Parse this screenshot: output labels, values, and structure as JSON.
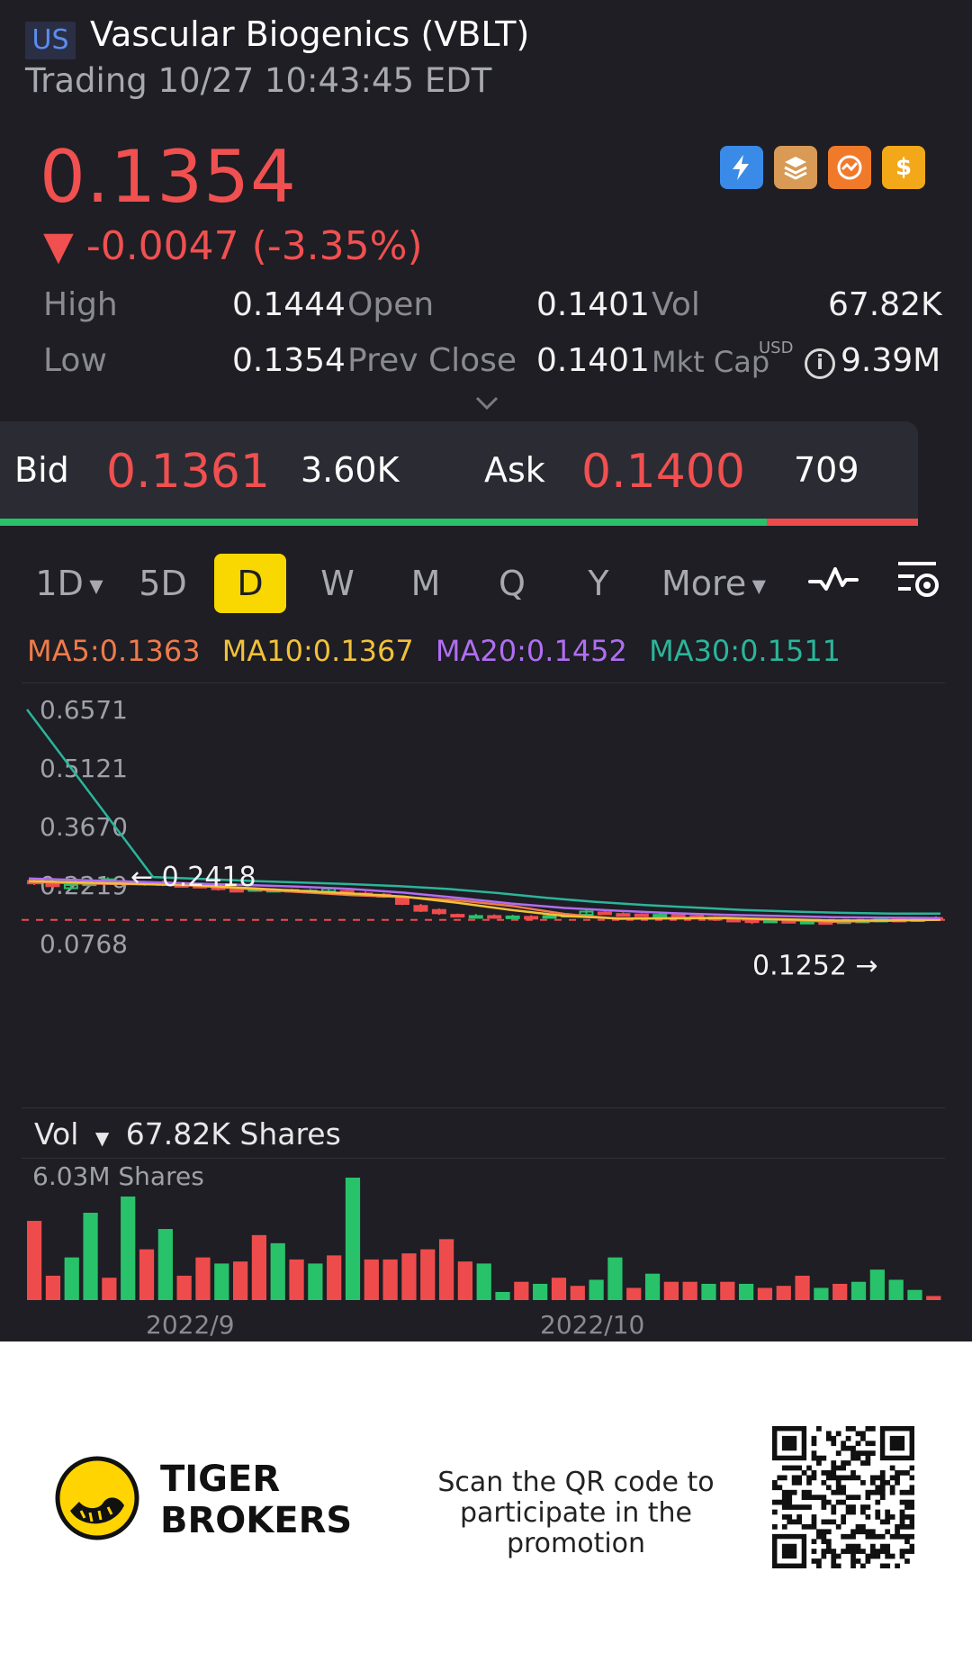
{
  "header": {
    "market": "US",
    "title": "Vascular Biogenics (VBLT)",
    "subtitle": "Trading 10/27 10:43:45 EDT"
  },
  "quote": {
    "price": "0.1354",
    "change": "▼ -0.0047 (-3.35%)",
    "high_label": "High",
    "high": "0.1444",
    "low_label": "Low",
    "low": "0.1354",
    "open_label": "Open",
    "open": "0.1401",
    "prev_close_label": "Prev Close",
    "prev_close": "0.1401",
    "vol_label": "Vol",
    "vol": "67.82K",
    "mkt_cap_label": "Mkt Cap",
    "mkt_cap_currency": "USD",
    "mkt_cap": "9.39M"
  },
  "bidask": {
    "bid_label": "Bid",
    "bid": "0.1361",
    "bid_size": "3.60K",
    "ask_label": "Ask",
    "ask": "0.1400",
    "ask_size": "709",
    "bid_ratio": 0.835
  },
  "tabs": [
    "1D",
    "5D",
    "D",
    "W",
    "M",
    "Q",
    "Y",
    "More"
  ],
  "active_tab": "D",
  "ma": {
    "ma5": "MA5:0.1363",
    "ma10": "MA10:0.1367",
    "ma20": "MA20:0.1452",
    "ma30": "MA30:0.1511"
  },
  "colors": {
    "up": "#28c26a",
    "down": "#ee4c4c",
    "ma5": "#f07a4a",
    "ma10": "#f2c13a",
    "ma20": "#b06ef2",
    "ma30": "#2bb59a",
    "accent": "#f8d800"
  },
  "chart_data": {
    "type": "line",
    "y_ticks": [
      "0.6571",
      "0.5121",
      "0.3670",
      "0.2219",
      "0.0768"
    ],
    "ylim": [
      0.0768,
      0.6571
    ],
    "max_marker": "0.2418",
    "min_marker": "0.1252",
    "current_price_line": 0.1354,
    "x_ticks": [
      "2022/9",
      "2022/10"
    ],
    "series": [
      {
        "name": "MA5",
        "values": [
          0.23,
          0.226,
          0.224,
          0.221,
          0.213,
          0.205,
          0.197,
          0.192,
          0.184,
          0.17,
          0.15,
          0.138,
          0.14,
          0.141,
          0.136,
          0.131,
          0.133,
          0.136
        ]
      },
      {
        "name": "MA10",
        "values": [
          0.232,
          0.228,
          0.225,
          0.222,
          0.215,
          0.208,
          0.201,
          0.193,
          0.178,
          0.16,
          0.145,
          0.139,
          0.139,
          0.14,
          0.137,
          0.134,
          0.134,
          0.136
        ]
      },
      {
        "name": "MA20",
        "values": [
          0.238,
          0.234,
          0.23,
          0.226,
          0.222,
          0.218,
          0.212,
          0.203,
          0.19,
          0.176,
          0.165,
          0.158,
          0.152,
          0.148,
          0.145,
          0.142,
          0.141,
          0.14
        ]
      },
      {
        "name": "MA30",
        "values": [
          0.6571,
          0.2418,
          0.237,
          0.232,
          0.228,
          0.224,
          0.219,
          0.212,
          0.202,
          0.19,
          0.18,
          0.172,
          0.166,
          0.16,
          0.156,
          0.153,
          0.151,
          0.1511
        ]
      }
    ],
    "candles": [
      [
        0.232,
        0.226,
        0.236,
        0.222
      ],
      [
        0.226,
        0.219,
        0.23,
        0.216
      ],
      [
        0.214,
        0.222,
        0.226,
        0.211
      ],
      [
        0.222,
        0.226,
        0.23,
        0.219
      ],
      [
        0.23,
        0.236,
        0.241,
        0.228
      ],
      [
        0.23,
        0.225,
        0.234,
        0.221
      ],
      [
        0.224,
        0.228,
        0.232,
        0.22
      ],
      [
        0.228,
        0.222,
        0.233,
        0.219
      ],
      [
        0.222,
        0.22,
        0.226,
        0.216
      ],
      [
        0.22,
        0.218,
        0.224,
        0.214
      ],
      [
        0.216,
        0.213,
        0.22,
        0.208
      ],
      [
        0.21,
        0.208,
        0.214,
        0.204
      ],
      [
        0.208,
        0.212,
        0.216,
        0.205
      ],
      [
        0.21,
        0.21,
        0.214,
        0.206
      ],
      [
        0.21,
        0.208,
        0.213,
        0.204
      ],
      [
        0.208,
        0.208,
        0.212,
        0.203
      ],
      [
        0.206,
        0.213,
        0.215,
        0.203
      ],
      [
        0.207,
        0.201,
        0.21,
        0.198
      ],
      [
        0.201,
        0.198,
        0.206,
        0.194
      ],
      [
        0.198,
        0.193,
        0.202,
        0.19
      ],
      [
        0.19,
        0.175,
        0.195,
        0.172
      ],
      [
        0.17,
        0.158,
        0.175,
        0.155
      ],
      [
        0.16,
        0.152,
        0.164,
        0.148
      ],
      [
        0.148,
        0.146,
        0.151,
        0.143
      ],
      [
        0.143,
        0.145,
        0.15,
        0.14
      ],
      [
        0.145,
        0.142,
        0.149,
        0.139
      ],
      [
        0.142,
        0.144,
        0.148,
        0.14
      ],
      [
        0.143,
        0.142,
        0.147,
        0.139
      ],
      [
        0.141,
        0.145,
        0.149,
        0.139
      ],
      [
        0.146,
        0.148,
        0.152,
        0.143
      ],
      [
        0.148,
        0.156,
        0.16,
        0.146
      ],
      [
        0.154,
        0.151,
        0.158,
        0.148
      ],
      [
        0.15,
        0.149,
        0.154,
        0.146
      ],
      [
        0.149,
        0.147,
        0.152,
        0.144
      ],
      [
        0.146,
        0.148,
        0.152,
        0.143
      ],
      [
        0.147,
        0.146,
        0.15,
        0.143
      ],
      [
        0.145,
        0.143,
        0.148,
        0.14
      ],
      [
        0.142,
        0.136,
        0.145,
        0.133
      ],
      [
        0.136,
        0.135,
        0.139,
        0.132
      ],
      [
        0.135,
        0.13,
        0.137,
        0.1252
      ],
      [
        0.131,
        0.134,
        0.137,
        0.129
      ],
      [
        0.133,
        0.132,
        0.136,
        0.129
      ],
      [
        0.131,
        0.131,
        0.134,
        0.128
      ],
      [
        0.13,
        0.128,
        0.133,
        0.126
      ],
      [
        0.128,
        0.132,
        0.135,
        0.127
      ],
      [
        0.131,
        0.134,
        0.137,
        0.129
      ],
      [
        0.134,
        0.136,
        0.139,
        0.132
      ],
      [
        0.136,
        0.135,
        0.14,
        0.132
      ],
      [
        0.136,
        0.137,
        0.141,
        0.133
      ],
      [
        0.14,
        0.1354,
        0.1444,
        0.1354
      ]
    ]
  },
  "volume": {
    "header": "Vol",
    "current": "67.82K Shares",
    "max_label": "6.03M Shares",
    "max": 6.03,
    "bars": [
      {
        "v": 3.9,
        "up": false
      },
      {
        "v": 1.2,
        "up": false
      },
      {
        "v": 2.1,
        "up": true
      },
      {
        "v": 4.3,
        "up": true
      },
      {
        "v": 1.1,
        "up": false
      },
      {
        "v": 5.1,
        "up": true
      },
      {
        "v": 2.5,
        "up": false
      },
      {
        "v": 3.5,
        "up": true
      },
      {
        "v": 1.2,
        "up": false
      },
      {
        "v": 2.1,
        "up": false
      },
      {
        "v": 1.8,
        "up": true
      },
      {
        "v": 1.9,
        "up": false
      },
      {
        "v": 3.2,
        "up": false
      },
      {
        "v": 2.8,
        "up": true
      },
      {
        "v": 2.0,
        "up": false
      },
      {
        "v": 1.8,
        "up": true
      },
      {
        "v": 2.2,
        "up": false
      },
      {
        "v": 6.03,
        "up": true
      },
      {
        "v": 2.0,
        "up": false
      },
      {
        "v": 2.0,
        "up": false
      },
      {
        "v": 2.3,
        "up": false
      },
      {
        "v": 2.5,
        "up": false
      },
      {
        "v": 3.0,
        "up": false
      },
      {
        "v": 1.9,
        "up": false
      },
      {
        "v": 1.8,
        "up": true
      },
      {
        "v": 0.4,
        "up": true
      },
      {
        "v": 0.9,
        "up": false
      },
      {
        "v": 0.8,
        "up": true
      },
      {
        "v": 1.1,
        "up": false
      },
      {
        "v": 0.7,
        "up": false
      },
      {
        "v": 1.0,
        "up": true
      },
      {
        "v": 2.1,
        "up": true
      },
      {
        "v": 0.6,
        "up": false
      },
      {
        "v": 1.3,
        "up": true
      },
      {
        "v": 0.9,
        "up": false
      },
      {
        "v": 0.9,
        "up": false
      },
      {
        "v": 0.8,
        "up": true
      },
      {
        "v": 0.9,
        "up": false
      },
      {
        "v": 0.8,
        "up": true
      },
      {
        "v": 0.6,
        "up": false
      },
      {
        "v": 0.7,
        "up": false
      },
      {
        "v": 1.2,
        "up": false
      },
      {
        "v": 0.6,
        "up": true
      },
      {
        "v": 0.8,
        "up": false
      },
      {
        "v": 0.9,
        "up": true
      },
      {
        "v": 1.5,
        "up": true
      },
      {
        "v": 1.0,
        "up": true
      },
      {
        "v": 0.5,
        "up": true
      },
      {
        "v": 0.2,
        "up": false
      }
    ]
  },
  "promo": {
    "brand_line1": "TIGER",
    "brand_line2": "BROKERS",
    "text_line1": "Scan the QR code to",
    "text_line2": "participate in the promotion"
  }
}
